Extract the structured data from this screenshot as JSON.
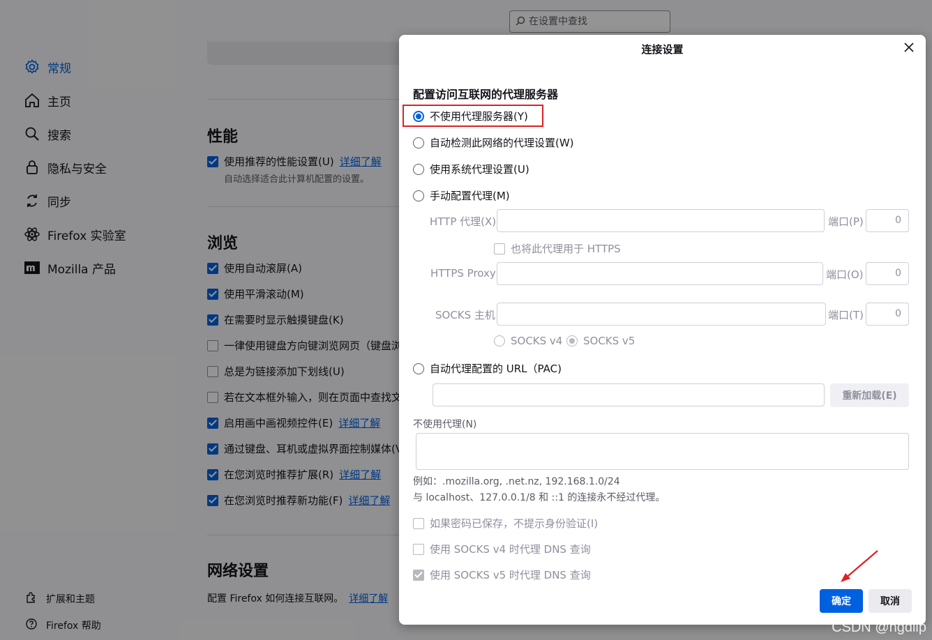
{
  "search": {
    "placeholder": "在设置中查找"
  },
  "sidebar": {
    "items": [
      {
        "label": "常规",
        "icon": "gear-icon",
        "active": true
      },
      {
        "label": "主页",
        "icon": "home-icon"
      },
      {
        "label": "搜索",
        "icon": "search-icon"
      },
      {
        "label": "隐私与安全",
        "icon": "lock-icon"
      },
      {
        "label": "同步",
        "icon": "sync-icon"
      },
      {
        "label": "Firefox 实验室",
        "icon": "labs-icon"
      },
      {
        "label": "Mozilla 产品",
        "icon": "mozilla-icon"
      }
    ],
    "footer": [
      {
        "label": "扩展和主题",
        "icon": "puzzle-icon"
      },
      {
        "label": "Firefox 帮助",
        "icon": "help-icon"
      }
    ]
  },
  "main": {
    "performance": {
      "title": "性能",
      "pref": "使用推荐的性能设置(U)",
      "link": "详细了解",
      "desc": "自动选择适合此计算机配置的设置。"
    },
    "browsing": {
      "title": "浏览",
      "prefs": [
        {
          "label": "使用自动滚屏(A)",
          "checked": true
        },
        {
          "label": "使用平滑滚动(M)",
          "checked": true
        },
        {
          "label": "在需要时显示触摸键盘(K)",
          "checked": true
        },
        {
          "label": "一律使用键盘方向键浏览网页（键盘浏",
          "checked": false
        },
        {
          "label": "总是为链接添加下划线(U)",
          "checked": false
        },
        {
          "label": "若在文本框外输入，则在页面中查找文",
          "checked": false
        },
        {
          "label": "启用画中画视频控件(E)",
          "checked": true,
          "link": "详细了解"
        },
        {
          "label": "通过键盘、耳机或虚拟界面控制媒体(V",
          "checked": true
        },
        {
          "label": "在您浏览时推荐扩展(R)",
          "checked": true,
          "link": "详细了解"
        },
        {
          "label": "在您浏览时推荐新功能(F)",
          "checked": true,
          "link": "详细了解"
        }
      ]
    },
    "network": {
      "title": "网络设置",
      "desc": "配置 Firefox 如何连接互联网。",
      "link": "详细了解"
    }
  },
  "dialog": {
    "title": "连接设置",
    "heading": "配置访问互联网的代理服务器",
    "options": {
      "no_proxy": "不使用代理服务器(Y)",
      "auto_detect": "自动检测此网络的代理设置(W)",
      "system": "使用系统代理设置(U)",
      "manual": "手动配置代理(M)",
      "pac": "自动代理配置的 URL（PAC)"
    },
    "http_label": "HTTP 代理(X)",
    "https_label": "HTTPS Proxy",
    "socks_label": "SOCKS 主机",
    "port_label_p": "端口(P)",
    "port_label_o": "端口(O)",
    "port_label_t": "端口(T)",
    "port_http": "0",
    "port_https": "0",
    "port_socks": "0",
    "also_https": "也将此代理用于 HTTPS",
    "socks_v4": "SOCKS v4",
    "socks_v5": "SOCKS v5",
    "reload_btn": "重新加载(E)",
    "no_proxy_for": "不使用代理(N)",
    "example": "例如：.mozilla.org, .net.nz, 192.168.1.0/24",
    "localhost_note": "与 localhost、127.0.0.1/8 和 ::1 的连接永不经过代理。",
    "check_auth": "如果密码已保存，不提示身份验证(I)",
    "check_dns_v4": "使用 SOCKS v4 时代理 DNS 查询",
    "check_dns_v5": "使用 SOCKS v5 时代理 DNS 查询",
    "ok": "确定",
    "cancel": "取消"
  },
  "watermark": "CSDN @hgdlip",
  "colors": {
    "accent": "#0061e0",
    "highlight": "#e02020"
  }
}
